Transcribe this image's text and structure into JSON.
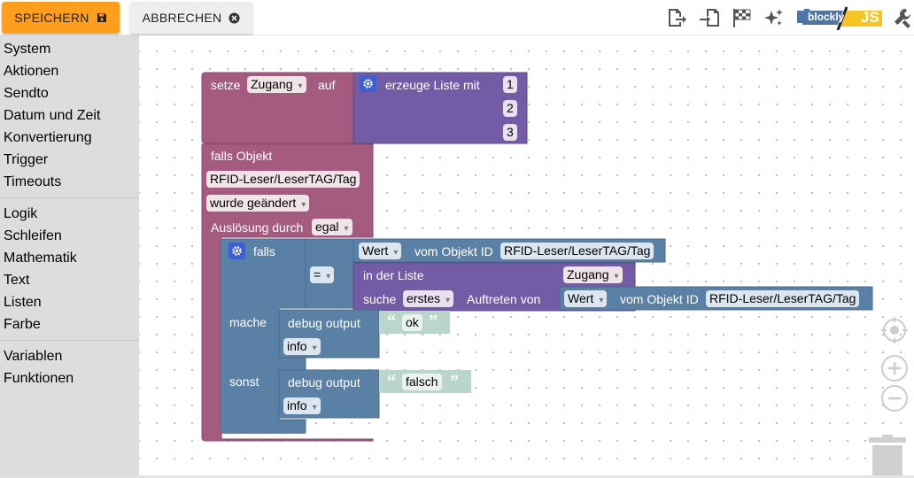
{
  "toolbar": {
    "save_label": "SPEICHERN",
    "cancel_label": "ABBRECHEN",
    "blockly_label": "blockly",
    "js_label": "JS"
  },
  "sidebar": {
    "items": [
      "System",
      "Aktionen",
      "Sendto",
      "Datum und Zeit",
      "Konvertierung",
      "Trigger",
      "Timeouts",
      "Logik",
      "Schleifen",
      "Mathematik",
      "Text",
      "Listen",
      "Farbe",
      "Variablen",
      "Funktionen"
    ]
  },
  "blocks": {
    "set_var": {
      "prefix": "setze",
      "var": "Zugang",
      "suffix": "auf"
    },
    "create_list": {
      "label": "erzeuge Liste mit",
      "items": [
        "1",
        "2",
        "3"
      ]
    },
    "trigger": {
      "label": "falls Objekt",
      "object_id": "RFID-Leser/LeserTAG/Tag",
      "condition": "wurde geändert",
      "trigger_label": "Auslösung durch",
      "trigger_value": "egal"
    },
    "if_block": {
      "if_label": "falls",
      "do_label": "mache",
      "else_label": "sonst"
    },
    "compare": {
      "op": "="
    },
    "get_value": {
      "attr": "Wert",
      "label": "vom Objekt ID",
      "object_id": "RFID-Leser/LeserTAG/Tag"
    },
    "in_list": {
      "label": "in der Liste",
      "var": "Zugang",
      "find_label": "suche",
      "find_mode": "erstes",
      "occ_label": "Auftreten von"
    },
    "get_value2": {
      "attr": "Wert",
      "label": "vom Objekt ID",
      "object_id": "RFID-Leser/LeserTAG/Tag"
    },
    "debug1": {
      "label": "debug output",
      "text": "ok",
      "level": "info"
    },
    "debug2": {
      "label": "debug output",
      "text": "falsch",
      "level": "info"
    }
  },
  "colors": {
    "accent": "#ff9d1c",
    "variable_block": "#a55b80",
    "list_block": "#745ba5",
    "logic_block": "#5b80a5",
    "text_block": "#b9d5cc",
    "sidebar_bg": "#dddddd"
  },
  "icons": [
    "save-icon",
    "close-circle-icon",
    "export-icon",
    "import-icon",
    "checkered-flag-icon",
    "sparkle-icon",
    "wrench-icon",
    "gear-icon",
    "target-icon",
    "zoom-in-icon",
    "zoom-out-icon",
    "trash-icon"
  ]
}
